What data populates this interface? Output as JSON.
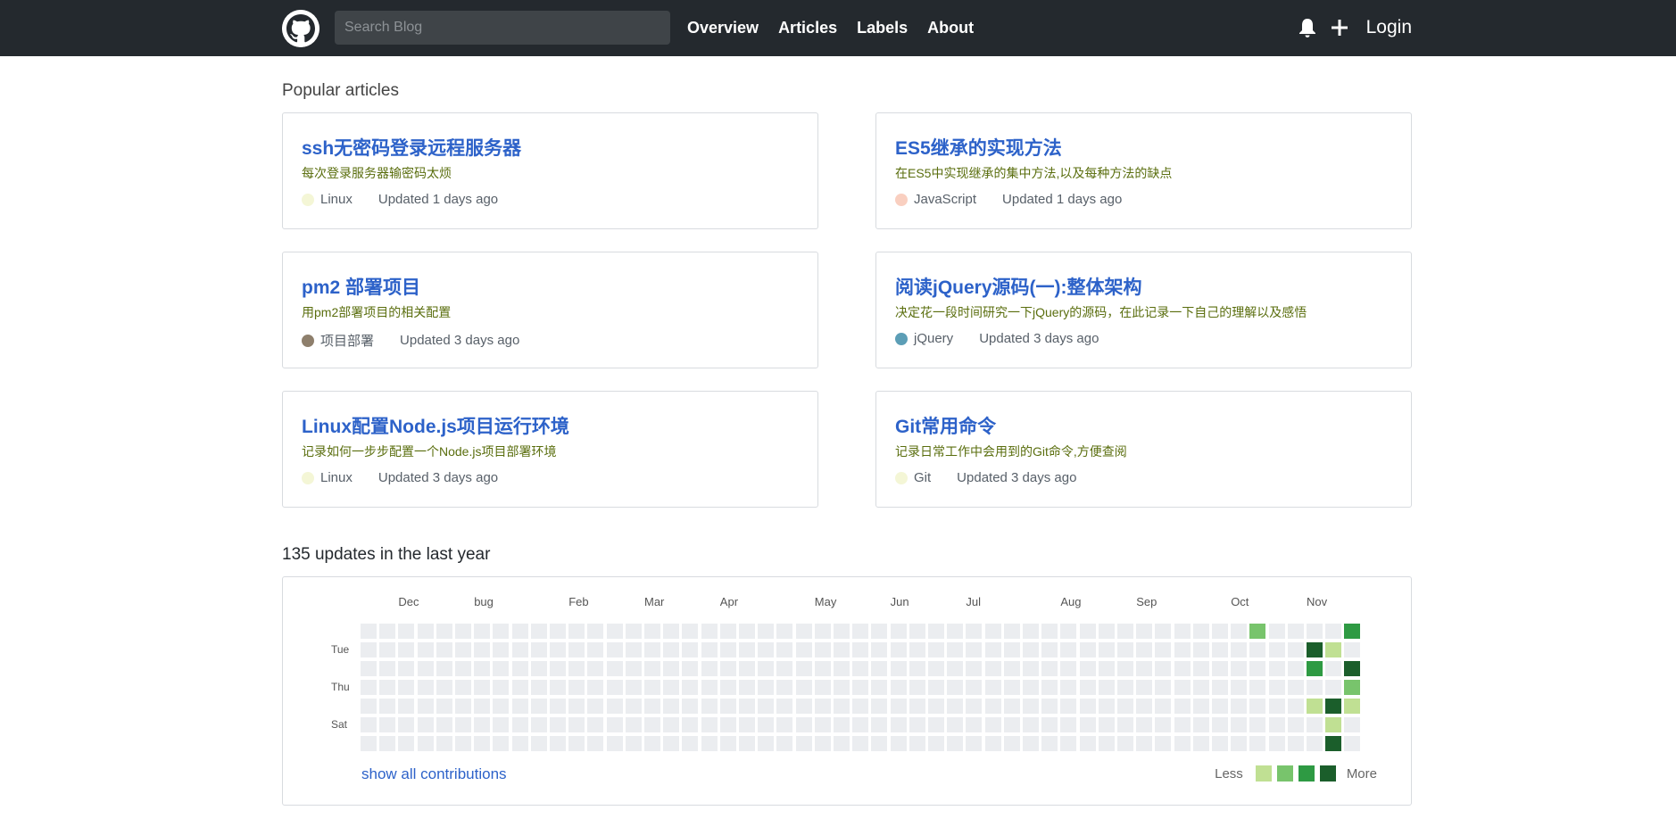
{
  "header": {
    "search_placeholder": "Search Blog",
    "nav": [
      "Overview",
      "Articles",
      "Labels",
      "About"
    ],
    "login": "Login"
  },
  "popular": {
    "title": "Popular articles",
    "articles": [
      {
        "title": "ssh无密码登录远程服务器",
        "desc": "每次登录服务器输密码太烦",
        "lang": "Linux",
        "lang_color": "#f4f6d6",
        "updated": "Updated 1 days ago"
      },
      {
        "title": "ES5继承的实现方法",
        "desc": "在ES5中实现继承的集中方法,以及每种方法的缺点",
        "lang": "JavaScript",
        "lang_color": "#f9cfc0",
        "updated": "Updated 1 days ago"
      },
      {
        "title": "pm2 部署项目",
        "desc": "用pm2部署项目的相关配置",
        "lang": "项目部署",
        "lang_color": "#8e7f6c",
        "updated": "Updated 3 days ago"
      },
      {
        "title": "阅读jQuery源码(一):整体架构",
        "desc": "决定花一段时间研究一下jQuery的源码，在此记录一下自己的理解以及感悟",
        "lang": "jQuery",
        "lang_color": "#5c9eb6",
        "updated": "Updated 3 days ago"
      },
      {
        "title": "Linux配置Node.js项目运行环境",
        "desc": "记录如何一步步配置一个Node.js项目部署环境",
        "lang": "Linux",
        "lang_color": "#f4f6d6",
        "updated": "Updated 3 days ago"
      },
      {
        "title": "Git常用命令",
        "desc": "记录日常工作中会用到的Git命令,方便查阅",
        "lang": "Git",
        "lang_color": "#f4f6d6",
        "updated": "Updated 3 days ago"
      }
    ]
  },
  "contributions": {
    "title": "135 updates in the last year",
    "months": [
      "Dec",
      "bug",
      "Feb",
      "Mar",
      "Apr",
      "May",
      "Jun",
      "Jul",
      "Aug",
      "Sep",
      "Oct",
      "Nov"
    ],
    "month_week_index": [
      2,
      6,
      11,
      15,
      19,
      24,
      28,
      32,
      37,
      41,
      46,
      50
    ],
    "days": [
      "Tue",
      "Thu",
      "Sat"
    ],
    "day_row_index": [
      1,
      3,
      5
    ],
    "weeks": 53,
    "active_cells": [
      {
        "week": 47,
        "day": 0,
        "level": 2
      },
      {
        "week": 52,
        "day": 0,
        "level": 3
      },
      {
        "week": 50,
        "day": 1,
        "level": 4
      },
      {
        "week": 51,
        "day": 1,
        "level": 1
      },
      {
        "week": 50,
        "day": 2,
        "level": 3
      },
      {
        "week": 52,
        "day": 2,
        "level": 4
      },
      {
        "week": 52,
        "day": 3,
        "level": 2
      },
      {
        "week": 50,
        "day": 4,
        "level": 1
      },
      {
        "week": 51,
        "day": 4,
        "level": 4
      },
      {
        "week": 52,
        "day": 4,
        "level": 1
      },
      {
        "week": 51,
        "day": 5,
        "level": 1
      },
      {
        "week": 51,
        "day": 6,
        "level": 4
      }
    ],
    "level_colors": [
      "#ebedf0",
      "#c0e093",
      "#78c46c",
      "#2e9a43",
      "#1b5e2b"
    ],
    "show_all": "show all contributions",
    "legend_less": "Less",
    "legend_more": "More"
  }
}
